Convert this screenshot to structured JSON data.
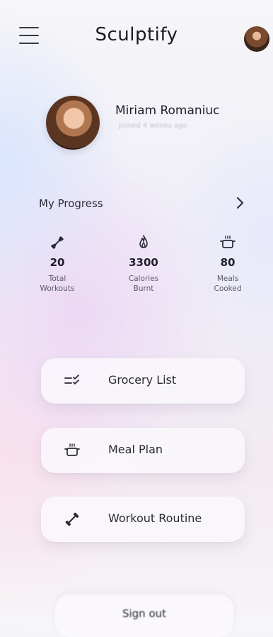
{
  "header": {
    "title": "Sculptify"
  },
  "profile": {
    "name": "Miriam Romaniuc",
    "subtitle": "Joined 4 weeks ago"
  },
  "progress": {
    "title": "My Progress",
    "stats": [
      {
        "value": "20",
        "label_line1": "Total",
        "label_line2": "Workouts",
        "icon": "dumbbell-icon"
      },
      {
        "value": "3300",
        "label_line1": "Calories",
        "label_line2": "Burnt",
        "icon": "flame-icon"
      },
      {
        "value": "80",
        "label_line1": "Meals",
        "label_line2": "Cooked",
        "icon": "pot-icon"
      }
    ]
  },
  "menu": [
    {
      "label": "Grocery List",
      "icon": "checklist-icon"
    },
    {
      "label": "Meal Plan",
      "icon": "pot-icon"
    },
    {
      "label": "Workout Routine",
      "icon": "dumbbell-icon"
    }
  ],
  "bottom": {
    "label": "Sign out"
  }
}
